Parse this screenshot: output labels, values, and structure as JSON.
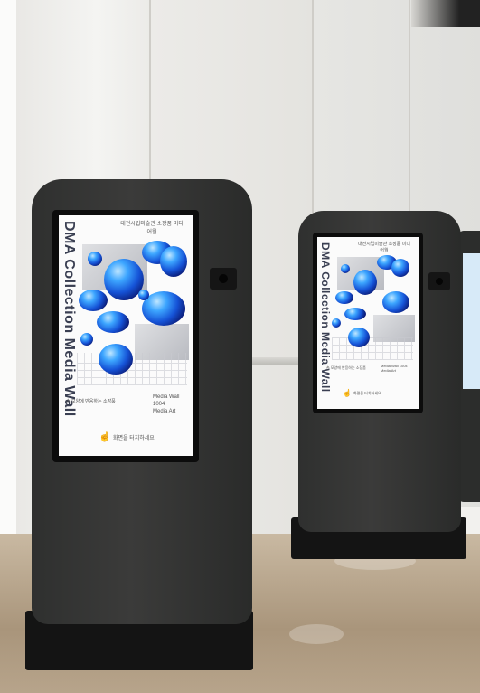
{
  "scene": {
    "kiosk_front": {
      "vertical_title": "DMA Collection Media Wall",
      "header_text": "대전시립미술관 소장품 미디어월",
      "caption_left": "손 모양에 반응하는 소장품",
      "caption_right_1": "Media Wall",
      "caption_right_2": "1004",
      "caption_right_3": "Media Art",
      "touch_prompt": "화면을 터치하세요"
    },
    "kiosk_back": {
      "vertical_title": "DMA Collection Media Wall",
      "header_text": "대전시립미술관 소장품 미디어월",
      "caption_left": "손 모양에 반응하는 소장품",
      "caption_right": "Media Wall 1004 Media Art",
      "touch_prompt": "화면을 터치하세요"
    }
  },
  "colors": {
    "kiosk_body": "#333433",
    "screen_bg": "#fbfbfb",
    "blob_blue": "#1552d6",
    "floor": "#b9a68c"
  },
  "icons": [
    "hand-touch-icon",
    "camera-icon"
  ]
}
